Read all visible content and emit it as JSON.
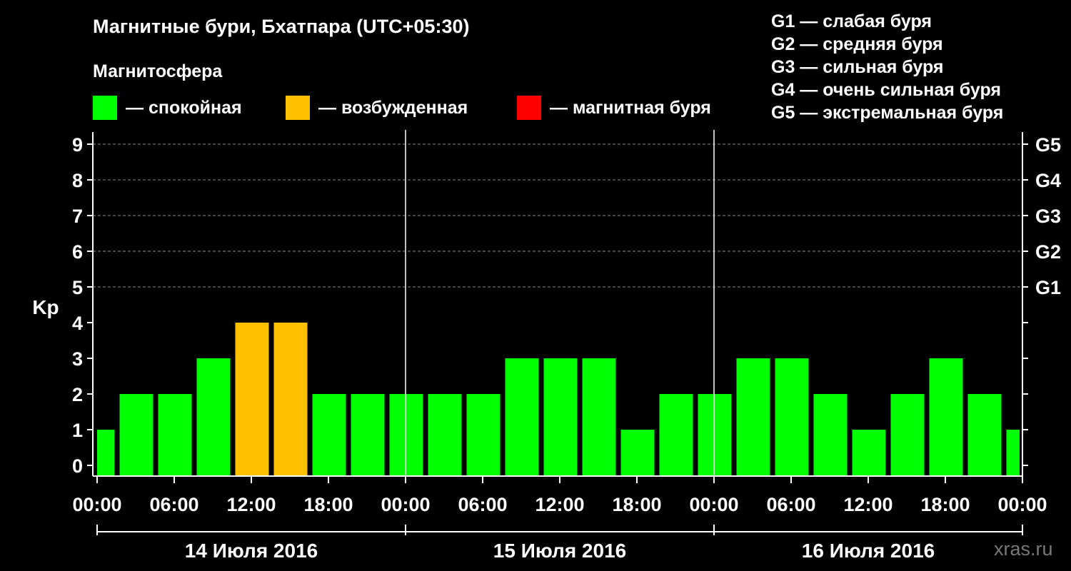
{
  "title": "Магнитные бури, Бхатпара (UTC+05:30)",
  "subtitle": "Магнитосфера",
  "legend": [
    {
      "color": "#00ff00",
      "label": "— спокойная"
    },
    {
      "color": "#ffc000",
      "label": "— возбужденная"
    },
    {
      "color": "#ff0000",
      "label": "— магнитная буря"
    }
  ],
  "storm_levels": [
    "G1 — слабая буря",
    "G2 — средняя буря",
    "G3 — сильная буря",
    "G4 — очень сильная буря",
    "G5 — экстремальная буря"
  ],
  "watermark": "xras.ru",
  "chart_data": {
    "type": "bar",
    "ylabel": "Kp",
    "ylim": [
      0,
      9
    ],
    "yticks": [
      0,
      1,
      2,
      3,
      4,
      5,
      6,
      7,
      8,
      9
    ],
    "right_ticks": [
      {
        "value": 5,
        "label": "G1"
      },
      {
        "value": 6,
        "label": "G2"
      },
      {
        "value": 7,
        "label": "G3"
      },
      {
        "value": 8,
        "label": "G4"
      },
      {
        "value": 9,
        "label": "G5"
      }
    ],
    "xticks": [
      "00:00",
      "06:00",
      "12:00",
      "18:00",
      "00:00",
      "06:00",
      "12:00",
      "18:00",
      "00:00",
      "06:00",
      "12:00",
      "18:00",
      "00:00"
    ],
    "days": [
      "14 Июля 2016",
      "15 Июля 2016",
      "16 Июля 2016"
    ],
    "grid": "horizontal dashed at Kp 5–9",
    "values": [
      1,
      2,
      2,
      3,
      4,
      4,
      2,
      2,
      2,
      2,
      2,
      3,
      3,
      3,
      1,
      2,
      2,
      3,
      3,
      2,
      1,
      2,
      3,
      2,
      1
    ],
    "colors": {
      "quiet": "#00ff00",
      "active": "#ffc000",
      "storm": "#ff0000"
    }
  }
}
